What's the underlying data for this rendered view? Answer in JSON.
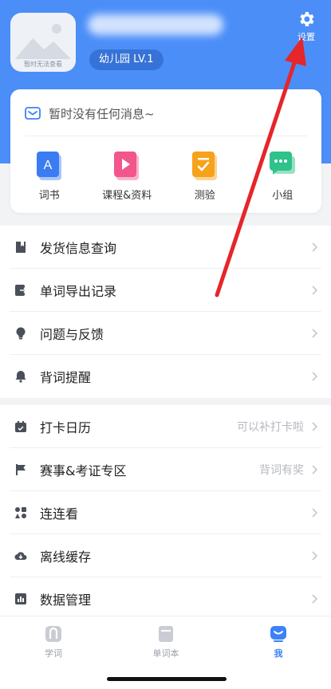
{
  "header": {
    "avatar_label": "暂时无法查看",
    "level": "幼儿园 LV.1",
    "settings_label": "设置"
  },
  "card": {
    "message": "暂时没有任何消息~",
    "quick_items": [
      {
        "label": "词书",
        "icon": "book-a-icon",
        "color": "#3b7cf3"
      },
      {
        "label": "课程&资料",
        "icon": "video-play-icon",
        "color": "#f2568c"
      },
      {
        "label": "测验",
        "icon": "quiz-check-icon",
        "color": "#f7a21b"
      },
      {
        "label": "小组",
        "icon": "chat-group-icon",
        "color": "#2fc28a"
      }
    ]
  },
  "menu1": [
    {
      "label": "发货信息查询",
      "icon": "bookmark-icon"
    },
    {
      "label": "单词导出记录",
      "icon": "export-icon"
    },
    {
      "label": "问题与反馈",
      "icon": "lightbulb-icon"
    },
    {
      "label": "背词提醒",
      "icon": "bell-icon"
    }
  ],
  "menu2": [
    {
      "label": "打卡日历",
      "icon": "calendar-icon",
      "hint": "可以补打卡啦"
    },
    {
      "label": "赛事&考证专区",
      "icon": "flag-icon",
      "hint": "背词有奖"
    },
    {
      "label": "连连看",
      "icon": "match-game-icon",
      "hint": ""
    },
    {
      "label": "离线缓存",
      "icon": "cloud-download-icon",
      "hint": ""
    },
    {
      "label": "数据管理",
      "icon": "bar-chart-icon",
      "hint": ""
    }
  ],
  "tabs": [
    {
      "label": "学词",
      "icon": "learn-icon"
    },
    {
      "label": "单词本",
      "icon": "wordbook-icon"
    },
    {
      "label": "我",
      "icon": "me-icon"
    }
  ],
  "colors": {
    "header_bg": "#4b8ef8",
    "accent": "#3c82f6",
    "annotation_arrow": "#e5262a"
  }
}
